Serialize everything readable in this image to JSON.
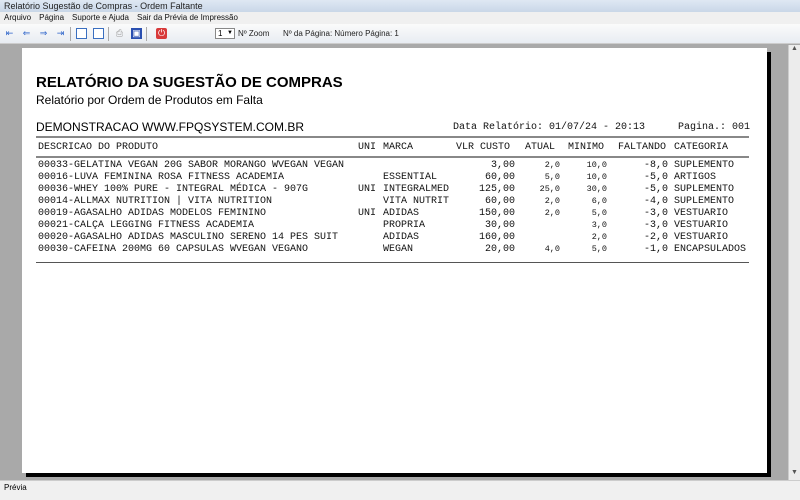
{
  "window": {
    "title": "Relatório Sugestão de Compras - Ordem Faltante"
  },
  "menu": [
    "Arquivo",
    "Página",
    "Suporte e Ajuda",
    "Sair da Prévia de Impressão"
  ],
  "toolbar": {
    "zoom_value": "1",
    "zoom_label": "Nº Zoom",
    "page_label": "Nº da Página: Número Página: 1"
  },
  "report": {
    "title": "RELATÓRIO DA SUGESTÃO DE COMPRAS",
    "subtitle": "Relatório por Ordem de Produtos em Falta",
    "company": "DEMONSTRACAO WWW.FPQSYSTEM.COM.BR",
    "date": "Data Relatório: 01/07/24 - 20:13",
    "page": "Pagina.: 001",
    "columns": {
      "desc": "DESCRICAO DO PRODUTO",
      "uni": "UNI",
      "marca": "MARCA",
      "vlr": "VLR CUSTO",
      "atual": "ATUAL",
      "minimo": "MINIMO",
      "faltando": "FALTANDO",
      "categoria": "CATEGORIA"
    },
    "rows": [
      {
        "desc": "00033-GELATINA VEGAN 20G SABOR MORANGO WVEGAN VEGAN",
        "uni": "",
        "marca": "",
        "vlr": "3,00",
        "atual": "2,0",
        "minimo": "10,0",
        "faltando": "-8,0",
        "categoria": "SUPLEMENTO"
      },
      {
        "desc": "00016-LUVA FEMININA ROSA FITNESS ACADEMIA",
        "uni": "",
        "marca": "ESSENTIAL",
        "vlr": "60,00",
        "atual": "5,0",
        "minimo": "10,0",
        "faltando": "-5,0",
        "categoria": "ARTIGOS"
      },
      {
        "desc": "00036-WHEY 100% PURE - INTEGRAL MÉDICA - 907G",
        "uni": "UNI",
        "marca": "INTEGRALMED",
        "vlr": "125,00",
        "atual": "25,0",
        "minimo": "30,0",
        "faltando": "-5,0",
        "categoria": "SUPLEMENTO"
      },
      {
        "desc": "00014-ALLMAX NUTRITION | VITA NUTRITION",
        "uni": "",
        "marca": "VITA NUTRIT",
        "vlr": "60,00",
        "atual": "2,0",
        "minimo": "6,0",
        "faltando": "-4,0",
        "categoria": "SUPLEMENTO"
      },
      {
        "desc": "00019-AGASALHO ADIDAS MODELOS FEMININO",
        "uni": "UNI",
        "marca": "ADIDAS",
        "vlr": "150,00",
        "atual": "2,0",
        "minimo": "5,0",
        "faltando": "-3,0",
        "categoria": "VESTUARIO"
      },
      {
        "desc": "00021-CALÇA LEGGING FITNESS ACADEMIA",
        "uni": "",
        "marca": "PROPRIA",
        "vlr": "30,00",
        "atual": "",
        "minimo": "3,0",
        "faltando": "-3,0",
        "categoria": "VESTUARIO"
      },
      {
        "desc": "00020-AGASALHO ADIDAS MASCULINO SERENO 14 PES SUIT",
        "uni": "",
        "marca": "ADIDAS",
        "vlr": "160,00",
        "atual": "",
        "minimo": "2,0",
        "faltando": "-2,0",
        "categoria": "VESTUARIO"
      },
      {
        "desc": "00030-CAFEINA 200MG 60 CAPSULAS WVEGAN VEGANO",
        "uni": "",
        "marca": "WEGAN",
        "vlr": "20,00",
        "atual": "4,0",
        "minimo": "5,0",
        "faltando": "-1,0",
        "categoria": "ENCAPSULADOS"
      }
    ]
  },
  "status": "Prévia"
}
